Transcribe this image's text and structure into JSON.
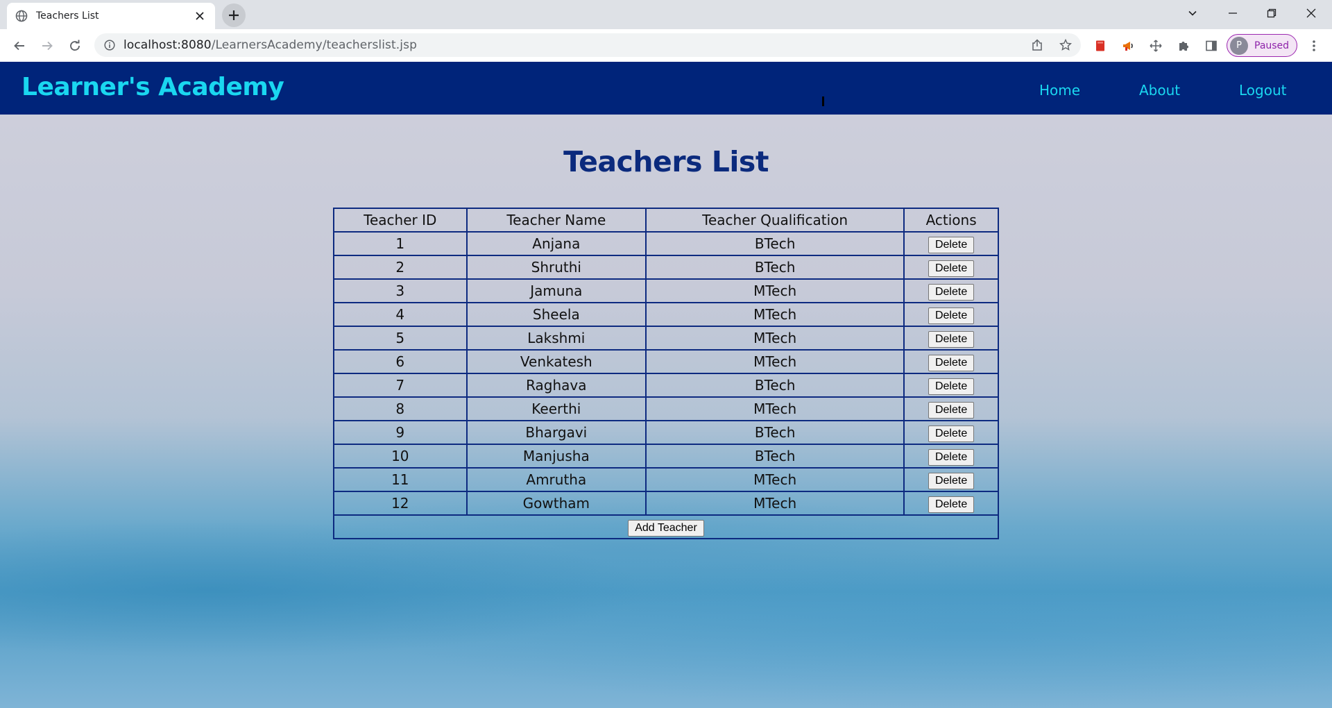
{
  "browser": {
    "tab_title": "Teachers List",
    "url_host": "localhost:8080",
    "url_path": "/LearnersAcademy/teacherslist.jsp",
    "profile_initial": "P",
    "profile_status": "Paused"
  },
  "navbar": {
    "brand": "Learner's Academy",
    "links": {
      "home": "Home",
      "about": "About",
      "logout": "Logout"
    }
  },
  "page": {
    "title": "Teachers List",
    "columns": [
      "Teacher ID",
      "Teacher Name",
      "Teacher Qualification",
      "Actions"
    ],
    "rows": [
      {
        "id": "1",
        "name": "Anjana",
        "qualification": "BTech",
        "action": "Delete"
      },
      {
        "id": "2",
        "name": "Shruthi",
        "qualification": "BTech",
        "action": "Delete"
      },
      {
        "id": "3",
        "name": "Jamuna",
        "qualification": "MTech",
        "action": "Delete"
      },
      {
        "id": "4",
        "name": "Sheela",
        "qualification": "MTech",
        "action": "Delete"
      },
      {
        "id": "5",
        "name": "Lakshmi",
        "qualification": "MTech",
        "action": "Delete"
      },
      {
        "id": "6",
        "name": "Venkatesh",
        "qualification": "MTech",
        "action": "Delete"
      },
      {
        "id": "7",
        "name": "Raghava",
        "qualification": "BTech",
        "action": "Delete"
      },
      {
        "id": "8",
        "name": "Keerthi",
        "qualification": "MTech",
        "action": "Delete"
      },
      {
        "id": "9",
        "name": "Bhargavi",
        "qualification": "BTech",
        "action": "Delete"
      },
      {
        "id": "10",
        "name": "Manjusha",
        "qualification": "BTech",
        "action": "Delete"
      },
      {
        "id": "11",
        "name": "Amrutha",
        "qualification": "MTech",
        "action": "Delete"
      },
      {
        "id": "12",
        "name": "Gowtham",
        "qualification": "MTech",
        "action": "Delete"
      }
    ],
    "add_button": "Add Teacher"
  },
  "colors": {
    "navbar_bg": "#00247a",
    "brand_accent": "#1ad7f0",
    "title_color": "#0b2a7d",
    "table_border": "#0d2a80"
  }
}
